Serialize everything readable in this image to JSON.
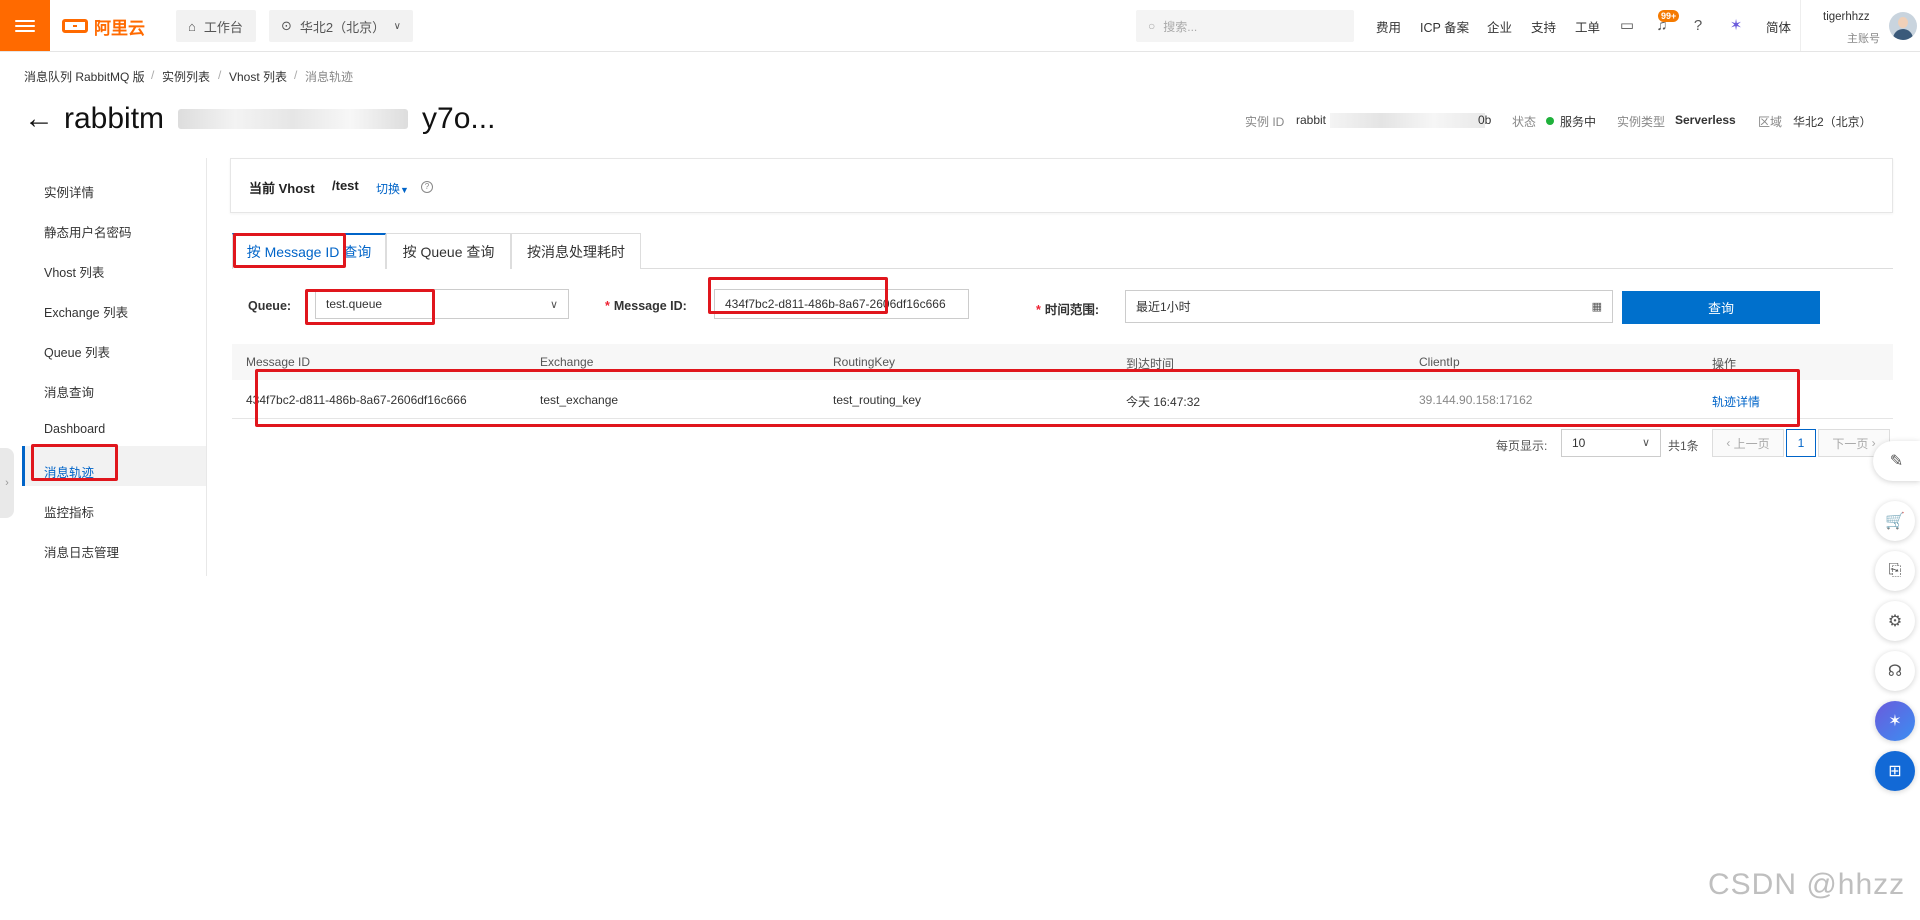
{
  "topbar": {
    "logo_text": "阿里云",
    "workbench": "工作台",
    "region": "华北2（北京）",
    "search_placeholder": "搜索...",
    "nav": [
      "费用",
      "ICP 备案",
      "企业",
      "支持",
      "工单"
    ],
    "badge": "99+",
    "lang": "简体",
    "user_name": "tigerhhzz",
    "user_role": "主账号"
  },
  "breadcrumb": [
    "消息队列 RabbitMQ 版",
    "实例列表",
    "Vhost 列表",
    "消息轨迹"
  ],
  "page": {
    "title_start": "rabbitm",
    "title_end": "y7o...",
    "instance_id_label": "实例 ID",
    "instance_id_prefix": "rabbit",
    "instance_id_suffix": "0b",
    "status_label": "状态",
    "status_value": "服务中",
    "type_label": "实例类型",
    "type_value": "Serverless",
    "region_label": "区域",
    "region_value": "华北2（北京）"
  },
  "sidebar": {
    "items": [
      "实例详情",
      "静态用户名密码",
      "Vhost 列表",
      "Exchange 列表",
      "Queue 列表",
      "消息查询",
      "Dashboard",
      "消息轨迹",
      "监控指标",
      "消息日志管理"
    ],
    "active": "消息轨迹"
  },
  "vhost": {
    "label": "当前 Vhost",
    "value": "/test",
    "switch": "切换"
  },
  "tabs": [
    "按 Message ID 查询",
    "按 Queue 查询",
    "按消息处理耗时"
  ],
  "form": {
    "queue_label": "Queue:",
    "queue_value": "test.queue",
    "msgid_label": "Message ID:",
    "msgid_value": "434f7bc2-d811-486b-8a67-2606df16c666",
    "time_label": "时间范围:",
    "time_value": "最近1小时",
    "submit": "查询"
  },
  "table": {
    "headers": [
      "Message ID",
      "Exchange",
      "RoutingKey",
      "到达时间",
      "ClientIp",
      "操作"
    ],
    "rows": [
      {
        "message_id": "434f7bc2-d811-486b-8a67-2606df16c666",
        "exchange": "test_exchange",
        "routing_key": "test_routing_key",
        "arrival": "今天 16:47:32",
        "client_ip": "39.144.90.158:17162",
        "action": "轨迹详情"
      }
    ]
  },
  "pagination": {
    "page_size_label": "每页显示:",
    "page_size": "10",
    "total": "共1条",
    "prev": "上一页",
    "current": "1",
    "next": "下一页"
  },
  "watermark": "CSDN @hhzz",
  "colors": {
    "brand": "#ff6a00",
    "primary": "#0064c8",
    "annotation": "#e0161d",
    "status_ok": "#1fb13b"
  }
}
